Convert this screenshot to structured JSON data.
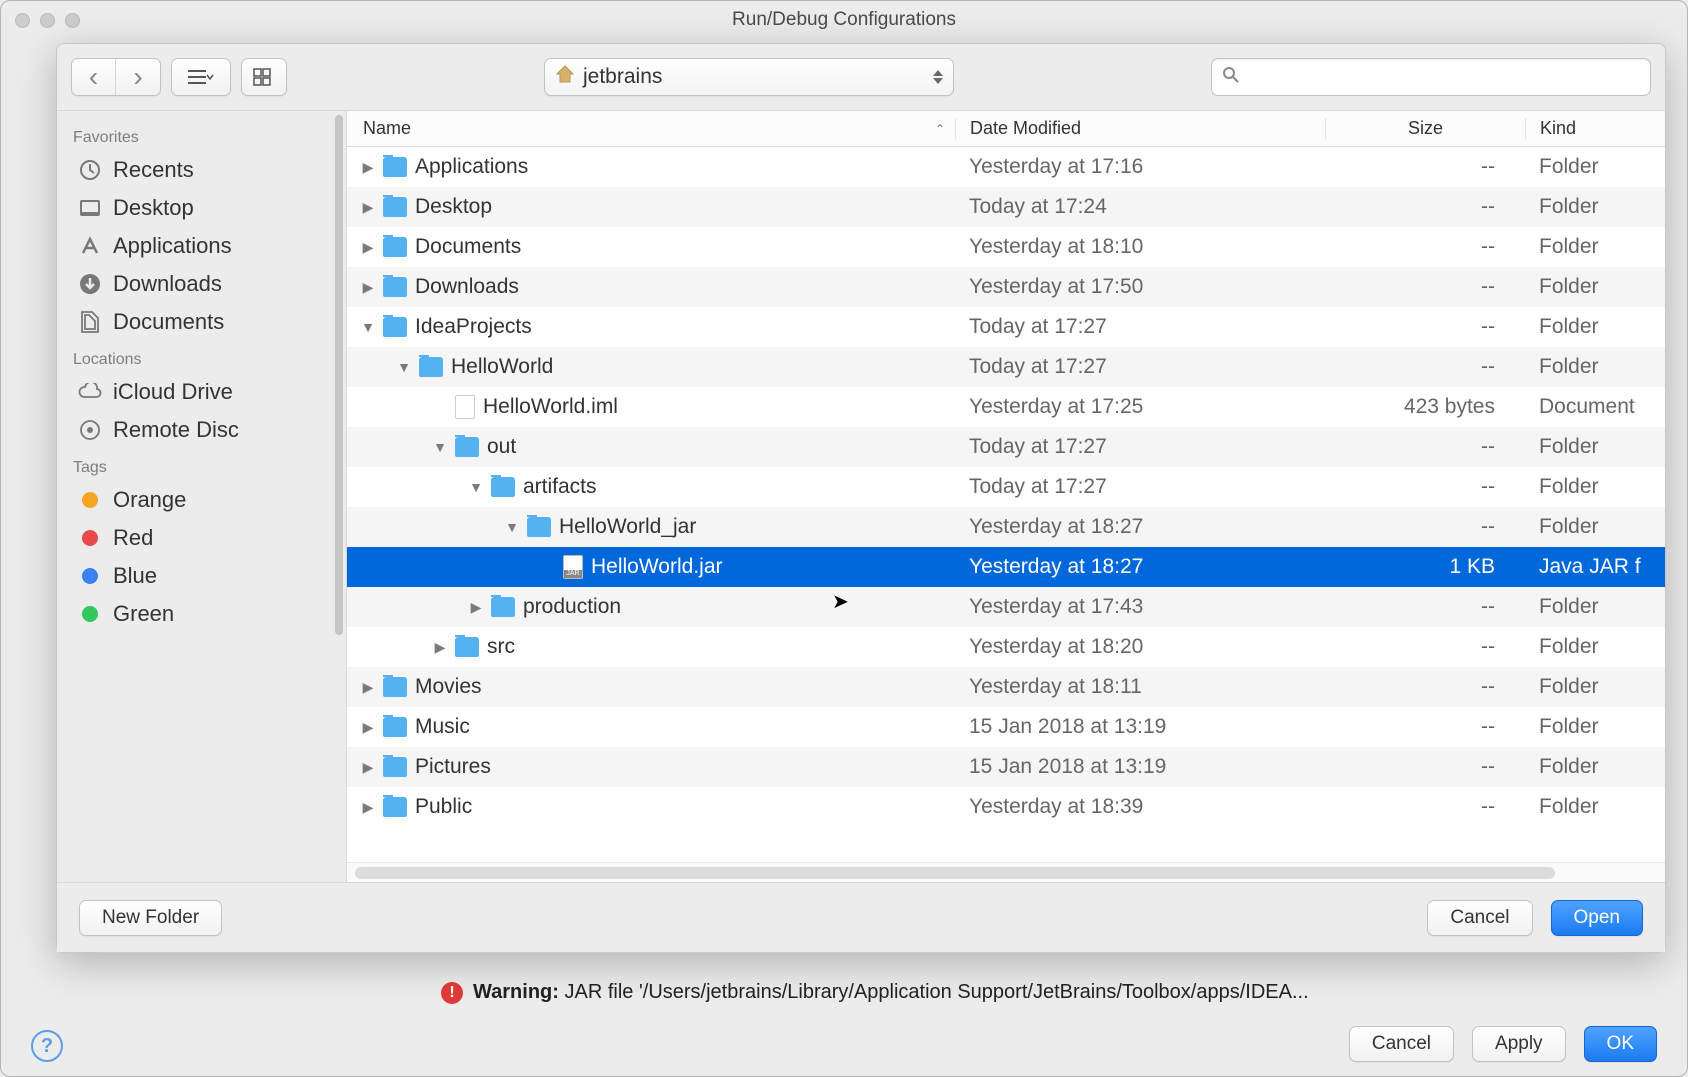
{
  "window": {
    "title": "Run/Debug Configurations"
  },
  "toolbar": {
    "path_label": "jetbrains",
    "search_placeholder": ""
  },
  "sidebar": {
    "favorites_heading": "Favorites",
    "favorites": [
      {
        "label": "Recents"
      },
      {
        "label": "Desktop"
      },
      {
        "label": "Applications"
      },
      {
        "label": "Downloads"
      },
      {
        "label": "Documents"
      }
    ],
    "locations_heading": "Locations",
    "locations": [
      {
        "label": "iCloud Drive"
      },
      {
        "label": "Remote Disc"
      }
    ],
    "tags_heading": "Tags",
    "tags": [
      {
        "label": "Orange",
        "color": "#f5a623"
      },
      {
        "label": "Red",
        "color": "#e94b4b"
      },
      {
        "label": "Blue",
        "color": "#3b82f6"
      },
      {
        "label": "Green",
        "color": "#34c759"
      }
    ]
  },
  "columns": {
    "name": "Name",
    "date": "Date Modified",
    "size": "Size",
    "kind": "Kind"
  },
  "rows": [
    {
      "name": "Applications",
      "date": "Yesterday at 17:16",
      "size": "--",
      "kind": "Folder",
      "indent": 0,
      "type": "folder",
      "disc": "right"
    },
    {
      "name": "Desktop",
      "date": "Today at 17:24",
      "size": "--",
      "kind": "Folder",
      "indent": 0,
      "type": "folder",
      "disc": "right"
    },
    {
      "name": "Documents",
      "date": "Yesterday at 18:10",
      "size": "--",
      "kind": "Folder",
      "indent": 0,
      "type": "folder",
      "disc": "right"
    },
    {
      "name": "Downloads",
      "date": "Yesterday at 17:50",
      "size": "--",
      "kind": "Folder",
      "indent": 0,
      "type": "folder",
      "disc": "right"
    },
    {
      "name": "IdeaProjects",
      "date": "Today at 17:27",
      "size": "--",
      "kind": "Folder",
      "indent": 0,
      "type": "folder",
      "disc": "down"
    },
    {
      "name": "HelloWorld",
      "date": "Today at 17:27",
      "size": "--",
      "kind": "Folder",
      "indent": 1,
      "type": "folder",
      "disc": "down"
    },
    {
      "name": "HelloWorld.iml",
      "date": "Yesterday at 17:25",
      "size": "423 bytes",
      "kind": "Document",
      "indent": 2,
      "type": "file",
      "disc": "none"
    },
    {
      "name": "out",
      "date": "Today at 17:27",
      "size": "--",
      "kind": "Folder",
      "indent": 2,
      "type": "folder",
      "disc": "down"
    },
    {
      "name": "artifacts",
      "date": "Today at 17:27",
      "size": "--",
      "kind": "Folder",
      "indent": 3,
      "type": "folder",
      "disc": "down"
    },
    {
      "name": "HelloWorld_jar",
      "date": "Yesterday at 18:27",
      "size": "--",
      "kind": "Folder",
      "indent": 4,
      "type": "folder",
      "disc": "down"
    },
    {
      "name": "HelloWorld.jar",
      "date": "Yesterday at 18:27",
      "size": "1 KB",
      "kind": "Java JAR f",
      "indent": 5,
      "type": "jar",
      "disc": "none",
      "selected": true
    },
    {
      "name": "production",
      "date": "Yesterday at 17:43",
      "size": "--",
      "kind": "Folder",
      "indent": 3,
      "type": "folder",
      "disc": "right"
    },
    {
      "name": "src",
      "date": "Yesterday at 18:20",
      "size": "--",
      "kind": "Folder",
      "indent": 2,
      "type": "folder",
      "disc": "right"
    },
    {
      "name": "Movies",
      "date": "Yesterday at 18:11",
      "size": "--",
      "kind": "Folder",
      "indent": 0,
      "type": "folder",
      "disc": "right"
    },
    {
      "name": "Music",
      "date": "15 Jan 2018 at 13:19",
      "size": "--",
      "kind": "Folder",
      "indent": 0,
      "type": "folder",
      "disc": "right"
    },
    {
      "name": "Pictures",
      "date": "15 Jan 2018 at 13:19",
      "size": "--",
      "kind": "Folder",
      "indent": 0,
      "type": "folder",
      "disc": "right"
    },
    {
      "name": "Public",
      "date": "Yesterday at 18:39",
      "size": "--",
      "kind": "Folder",
      "indent": 0,
      "type": "folder",
      "disc": "right"
    }
  ],
  "sheet_footer": {
    "new_folder": "New Folder",
    "cancel": "Cancel",
    "open": "Open"
  },
  "warning": {
    "label": "Warning:",
    "text": " JAR file '/Users/jetbrains/Library/Application Support/JetBrains/Toolbox/apps/IDEA..."
  },
  "main_footer": {
    "cancel": "Cancel",
    "apply": "Apply",
    "ok": "OK"
  }
}
